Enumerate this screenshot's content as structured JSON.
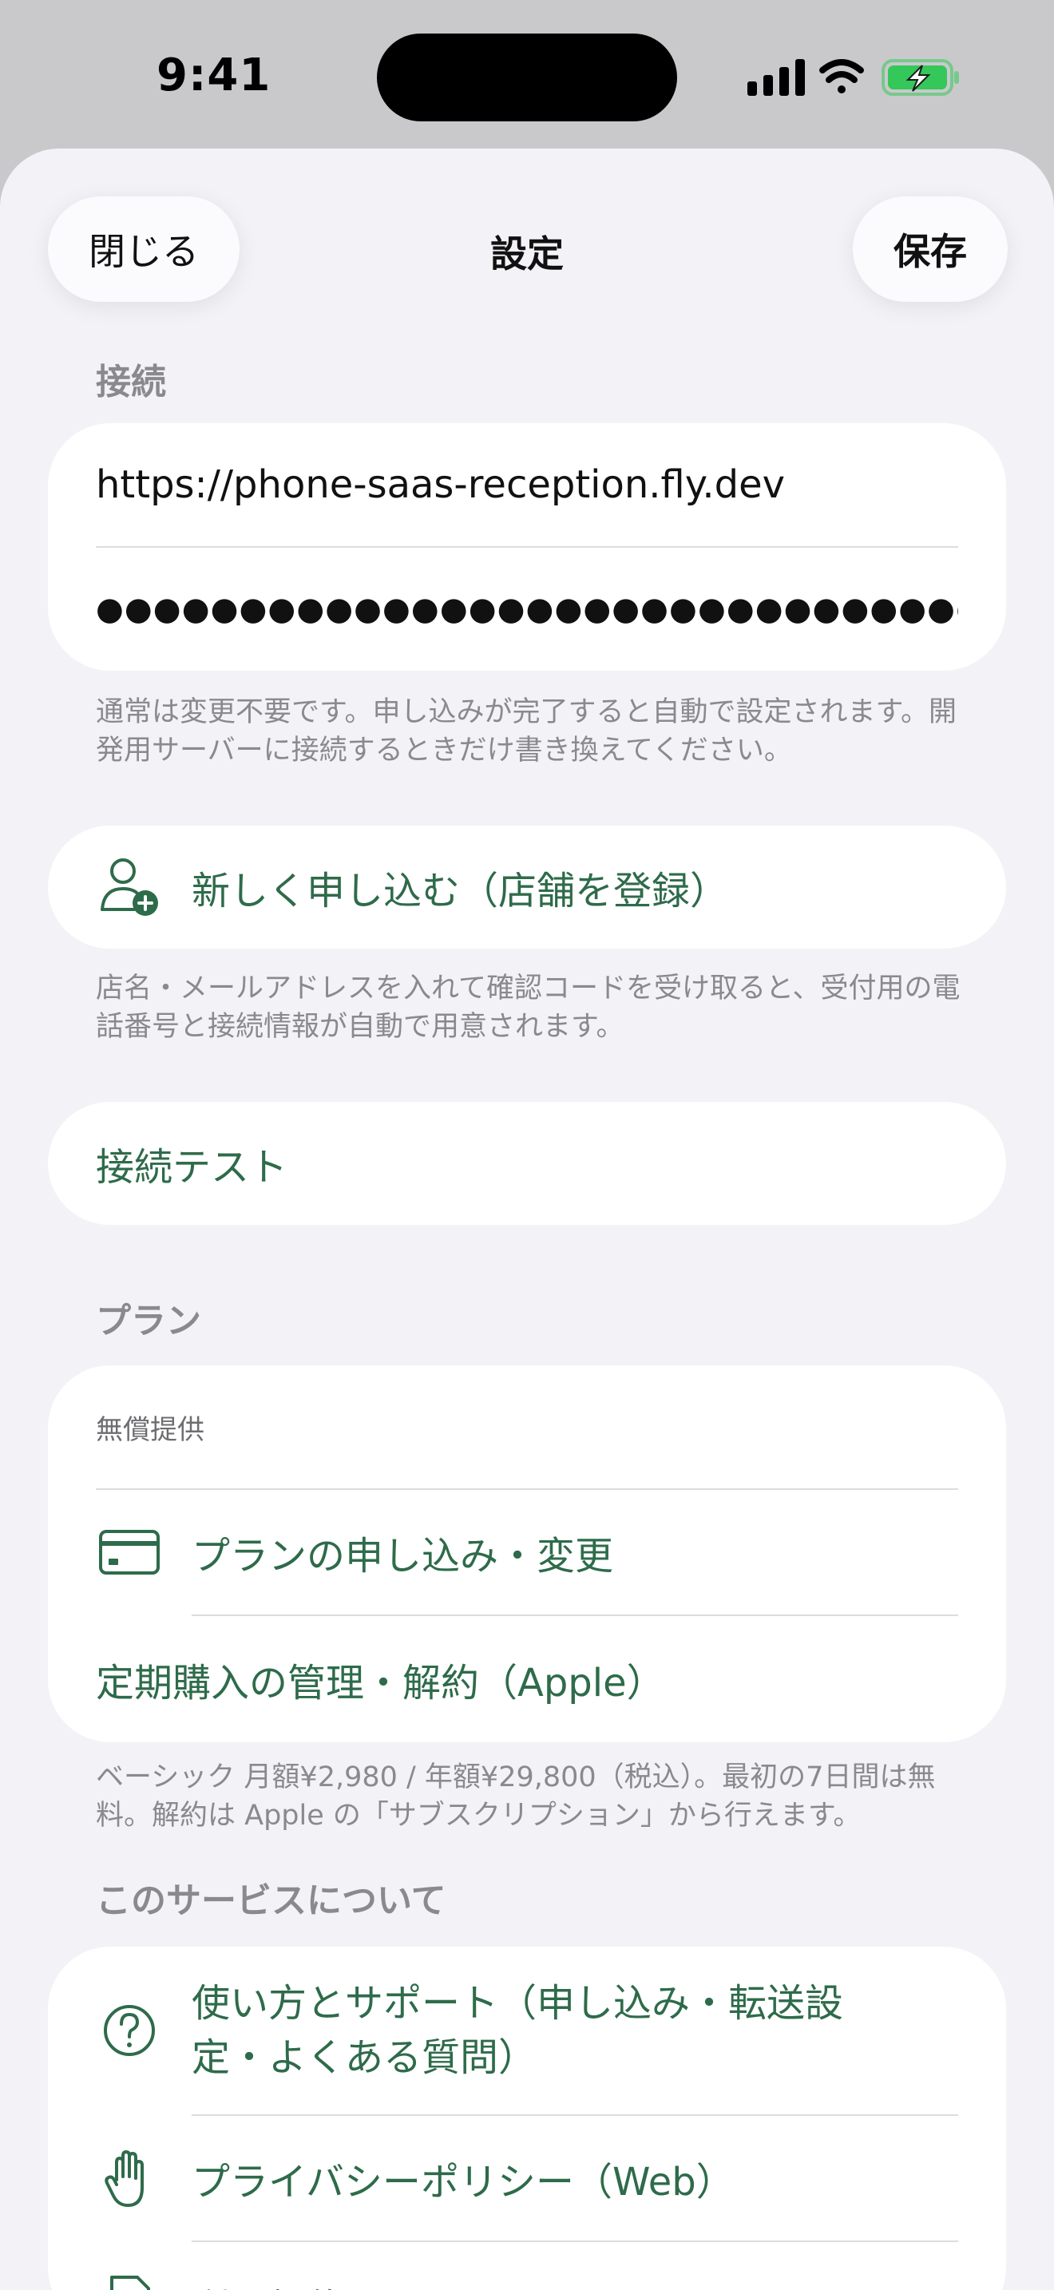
{
  "status_bar": {
    "time": "9:41"
  },
  "nav": {
    "close": "閉じる",
    "title": "設定",
    "save": "保存"
  },
  "connection": {
    "header": "接続",
    "server_url": "https://phone-saas-reception.fly.dev",
    "api_key_masked": "●●●●●●●●●●●●●●●●●●●●●●●●●●●●●●●...",
    "footer": "通常は変更不要です。申し込みが完了すると自動で設定されます。開発用サーバーに接続するときだけ書き換えてください。"
  },
  "signup": {
    "label": "新しく申し込む（店舗を登録）",
    "footer": "店名・メールアドレスを入れて確認コードを受け取ると、受付用の電話番号と接続情報が自動で用意されます。"
  },
  "test": {
    "label": "接続テスト"
  },
  "plan": {
    "header": "プラン",
    "status": "無償提供",
    "apply": "プランの申し込み・変更",
    "manage": "定期購入の管理・解約（Apple）",
    "footer": "ベーシック 月額¥2,980 / 年額¥29,800（税込）。最初の7日間は無料。解約は Apple の「サブスクリプション」から行えます。"
  },
  "about": {
    "header": "このサービスについて",
    "help": "使い方とサポート（申し込み・転送設定・よくある質問）",
    "privacy": "プライバシーポリシー（Web）",
    "terms": "利用規約"
  },
  "colors": {
    "accent": "#2e6b4a",
    "background": "#f2f2f7",
    "secondary_text": "#8a8a8e"
  }
}
